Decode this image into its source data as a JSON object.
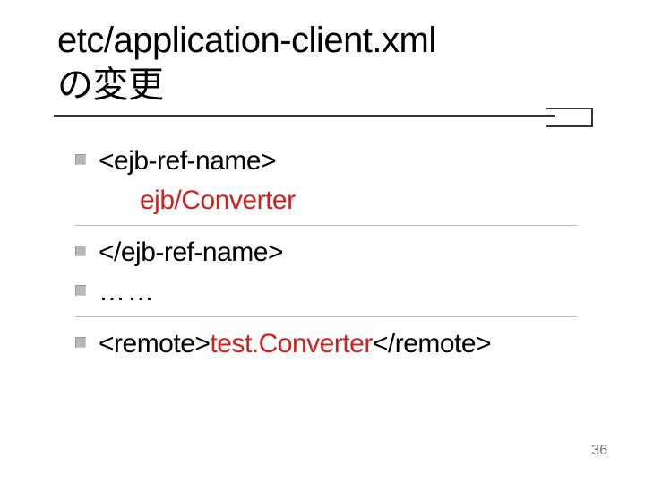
{
  "title_line1": "etc/application-client.xml",
  "title_line2": "の変更",
  "body": {
    "line1": "<ejb-ref-name>",
    "line2_indent": "ejb/Converter",
    "line3": "</ejb-ref-name>",
    "line4_dots": "……",
    "line5_pre": "<remote>",
    "line5_mid": "test.Converter",
    "line5_post": "</remote>"
  },
  "page_number": "36"
}
